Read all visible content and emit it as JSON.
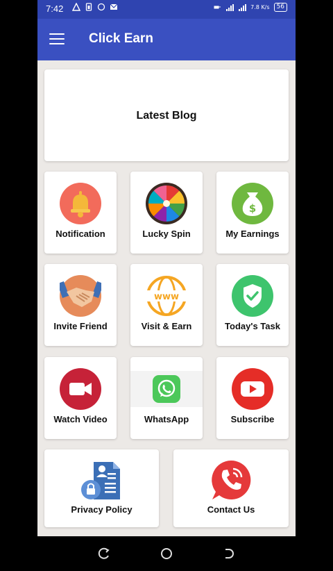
{
  "status_bar": {
    "time": "7:42",
    "network_speed": "7.8 K/s",
    "battery": "56"
  },
  "app_bar": {
    "title": "Click Earn",
    "menu_icon": "hamburger-menu-icon"
  },
  "blog_card": {
    "title": "Latest Blog"
  },
  "tiles": [
    {
      "label": "Notification",
      "icon": "bell-icon"
    },
    {
      "label": "Lucky Spin",
      "icon": "spin-wheel-icon"
    },
    {
      "label": "My Earnings",
      "icon": "money-bag-icon"
    },
    {
      "label": "Invite Friend",
      "icon": "handshake-icon"
    },
    {
      "label": "Visit & Earn",
      "icon": "www-globe-icon"
    },
    {
      "label": "Today's Task",
      "icon": "shield-check-icon"
    },
    {
      "label": "Watch Video",
      "icon": "video-camera-icon"
    },
    {
      "label": "WhatsApp",
      "icon": "whatsapp-icon"
    },
    {
      "label": "Subscribe",
      "icon": "youtube-icon"
    }
  ],
  "wide_tiles": [
    {
      "label": "Privacy Policy",
      "icon": "privacy-document-icon"
    },
    {
      "label": "Contact Us",
      "icon": "phone-call-icon"
    }
  ],
  "colors": {
    "app_bar": "#3a50c1",
    "status_bar": "#2f44b0",
    "background": "#ece9e6"
  }
}
